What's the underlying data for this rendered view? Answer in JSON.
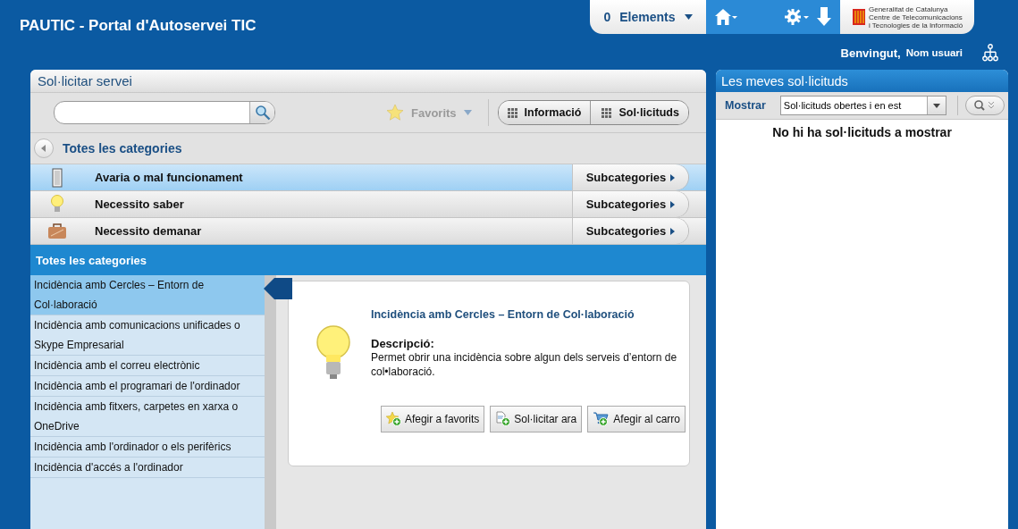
{
  "header": {
    "title": "PAUTIC - Portal d'Autoservei TIC",
    "cart_count": "0",
    "cart_label": "Elements",
    "logo_lines": [
      "Generalitat de Catalunya",
      "Centre de Telecomunicacions",
      "i Tecnologies de la Informació"
    ],
    "welcome": "Benvingut,",
    "user": "Nom usuari"
  },
  "service_panel": {
    "title": "Sol·licitar servei",
    "favorites": {
      "label": "Favorits",
      "disabled": true
    },
    "view_buttons": [
      "Informació",
      "Sol·licituds"
    ],
    "breadcrumb": "Totes les categories",
    "categories": [
      {
        "label": "Avaria o mal funcionament",
        "action": "Subcategories",
        "selected": true
      },
      {
        "label": "Necessito saber",
        "action": "Subcategories",
        "selected": false
      },
      {
        "label": "Necessito demanar",
        "action": "Subcategories",
        "selected": false
      }
    ],
    "section_title": "Totes les categories",
    "subcategories": [
      {
        "label": "Incidència amb Cercles – Entorn de Col·laboració",
        "selected": true
      },
      {
        "label": "Incidència amb comunicacions unificades o Skype Empresarial",
        "selected": false
      },
      {
        "label": "Incidència amb el correu electrònic",
        "selected": false
      },
      {
        "label": "Incidència amb el programari de l'ordinador",
        "selected": false
      },
      {
        "label": "Incidència amb fitxers, carpetes en xarxa o OneDrive",
        "selected": false
      },
      {
        "label": "Incidència amb l'ordinador o els perifèrics",
        "selected": false
      },
      {
        "label": "Incidència d'accés a l'ordinador",
        "selected": false
      }
    ],
    "detail": {
      "title": "Incidència amb Cercles – Entorn de Col·laboració",
      "description_label": "Descripció:",
      "description": "Permet obrir una incidència sobre algun dels serveis d’entorn de col•laboració.",
      "actions": [
        "Afegir a favorits",
        "Sol·licitar ara",
        "Afegir al carro"
      ]
    }
  },
  "requests_panel": {
    "title": "Les meves sol·licituds",
    "filter_label": "Mostrar",
    "filter_value": "Sol·licituds obertes i en est",
    "empty_message": "No hi ha sol·licituds a mostrar"
  }
}
